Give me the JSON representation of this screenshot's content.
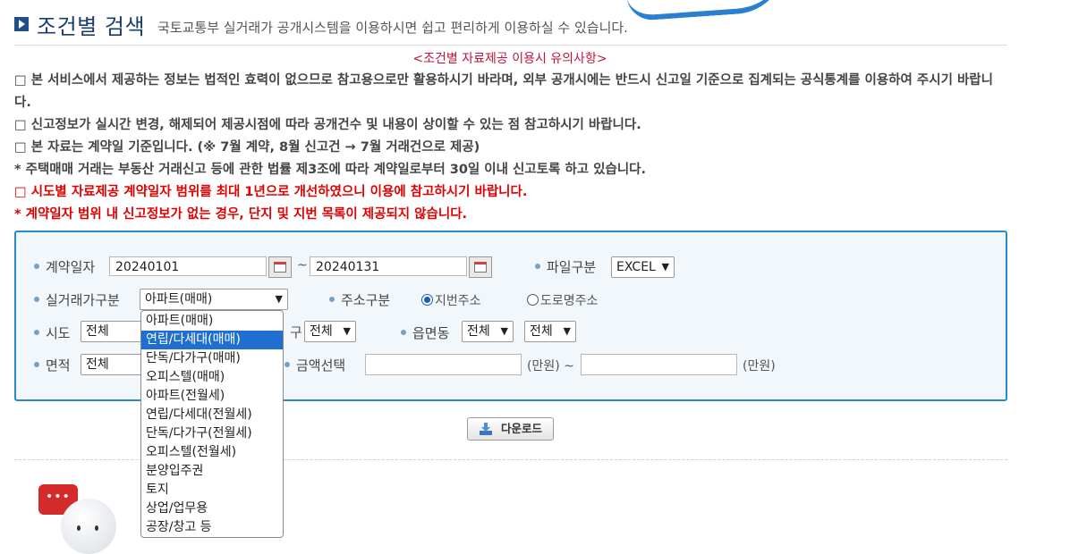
{
  "header": {
    "title": "조건별 검색",
    "description": "국토교통부 실거래가 공개시스템을 이용하시면 쉽고 편리하게 이용하실 수 있습니다."
  },
  "notice": {
    "title": "<조건별 자료제공 이용시 유의사항>",
    "lines": [
      "□ 본 서비스에서 제공하는 정보는 법적인 효력이 없으므로 참고용으로만 활용하시기 바라며, 외부 공개시에는 반드시 신고일 기준으로 집계되는 공식통계를 이용하여 주시기 바랍니다.",
      "□ 신고정보가 실시간 변경, 해제되어 제공시점에 따라 공개건수 및 내용이 상이할 수 있는 점 참고하시기 바랍니다.",
      "□ 본 자료는 계약일 기준입니다. (※ 7월 계약, 8월 신고건 → 7월 거래건으로 제공)",
      "* 주택매매 거래는 부동산 거래신고 등에 관한 법률 제3조에 따라 계약일로부터 30일 이내 신고토록 하고 있습니다.",
      "□ 시도별 자료제공 계약일자 범위를 최대 1년으로 개선하였으니 이용에 참고하시기 바랍니다.",
      "* 계약일자 범위 내 신고정보가 없는 경우, 단지 및 지번 목록이 제공되지 않습니다."
    ]
  },
  "form": {
    "contract_date_label": "계약일자",
    "date_from": "20240101",
    "date_sep": "~",
    "date_to": "20240131",
    "file_type_label": "파일구분",
    "file_type_value": "EXCEL",
    "deal_type_label": "실거래가구분",
    "deal_type_value": "아파트(매매)",
    "address_type_label": "주소구분",
    "radio_jibun": "지번주소",
    "radio_road": "도로명주소",
    "sido_label": "시도",
    "sido_value": "전체",
    "sigungu_label_partial": "구",
    "sigungu_value": "전체",
    "eupmyeondong_label": "읍면동",
    "eupmyeondong_value": "전체",
    "eupmyeondong_value2": "전체",
    "area_label": "면적",
    "area_value": "전체",
    "amount_label": "금액선택",
    "amount_unit_from": "(만원) ~",
    "amount_unit_to": "(만원)",
    "amount_from": "",
    "amount_to": ""
  },
  "dropdown": {
    "options": [
      "아파트(매매)",
      "연립/다세대(매매)",
      "단독/다가구(매매)",
      "오피스텔(매매)",
      "아파트(전월세)",
      "연립/다세대(전월세)",
      "단독/다가구(전월세)",
      "오피스텔(전월세)",
      "분양입주권",
      "토지",
      "상업/업무용",
      "공장/창고 등"
    ],
    "highlighted": "연립/다세대(매매)"
  },
  "download": {
    "label": "다운로드"
  },
  "icons": {
    "title_bullet": "play-square-icon",
    "calendar": "calendar-icon",
    "download": "download-icon",
    "chat": "chat-bubble-icon"
  },
  "colors": {
    "accent_blue": "#2a8ac8",
    "notice_red": "#e00000",
    "highlight": "#1e6fd0"
  }
}
